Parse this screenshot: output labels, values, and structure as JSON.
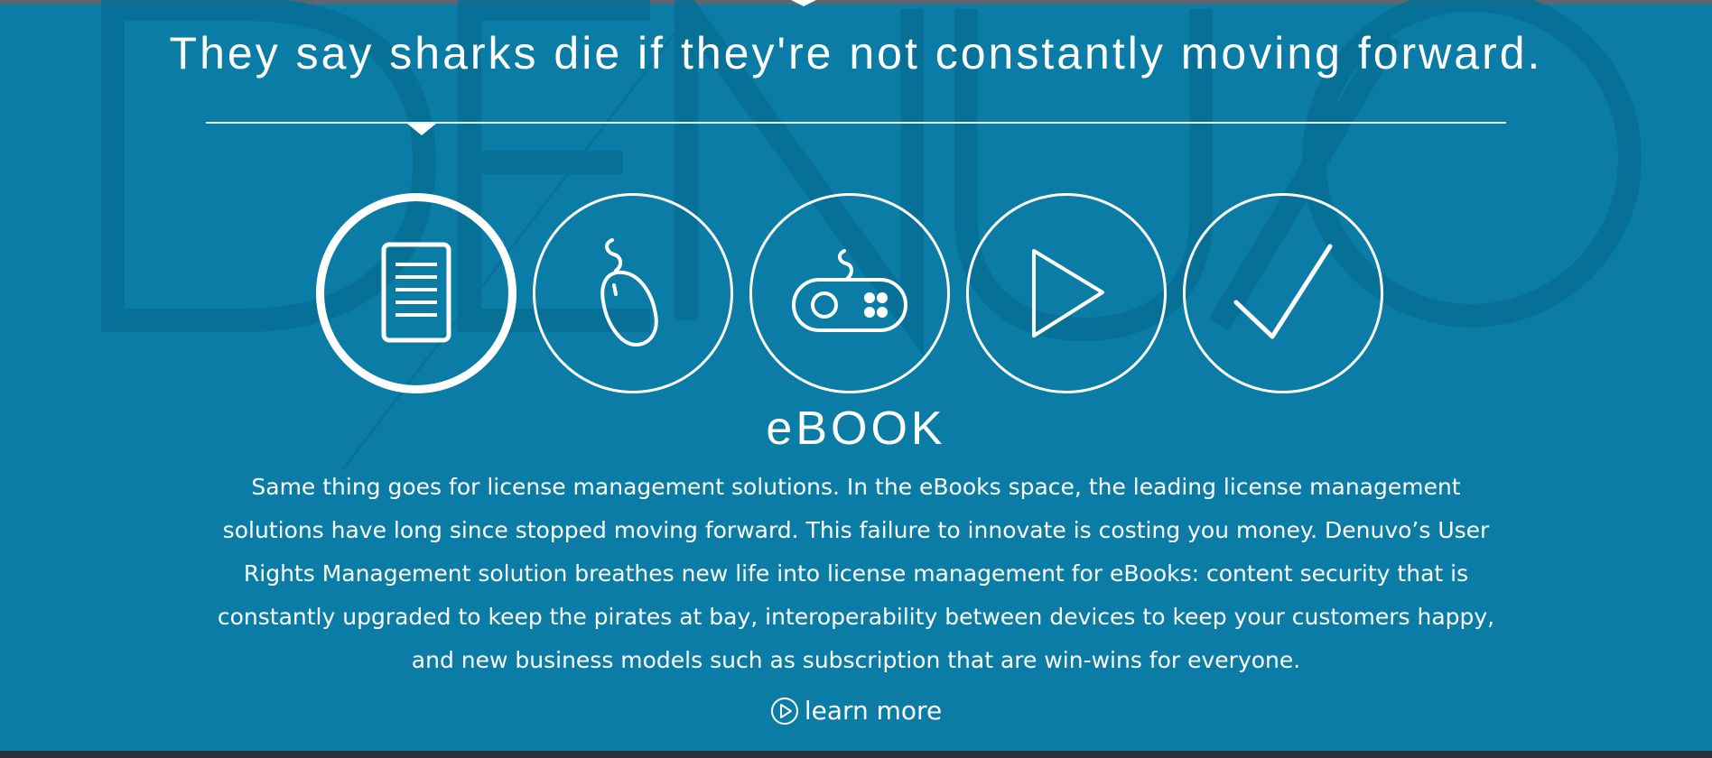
{
  "headline": "They say sharks die if they're not constantly moving forward.",
  "watermark": {
    "text": "DENUVO"
  },
  "icons": [
    {
      "name": "ebook-icon",
      "active": true
    },
    {
      "name": "mouse-icon",
      "active": false
    },
    {
      "name": "gamepad-icon",
      "active": false
    },
    {
      "name": "play-icon",
      "active": false
    },
    {
      "name": "checkmark-icon",
      "active": false
    }
  ],
  "product": {
    "title": "eBOOK",
    "description": "Same thing goes for license management solutions. In the eBooks space, the leading license management solutions have long since stopped moving forward. This failure to innovate is costing you money. Denuvo’s User Rights Management solution breathes new life into license management for eBooks: content security that is constantly upgraded to keep the pirates at bay, interoperability between devices to keep your customers happy, and new business models such as subscription that are win-wins for everyone."
  },
  "learn_more": {
    "label": "learn more",
    "icon": "play-circle-icon"
  },
  "colors": {
    "background": "#0a7ca6",
    "foreground": "#ffffff",
    "watermark": "#08739a"
  }
}
